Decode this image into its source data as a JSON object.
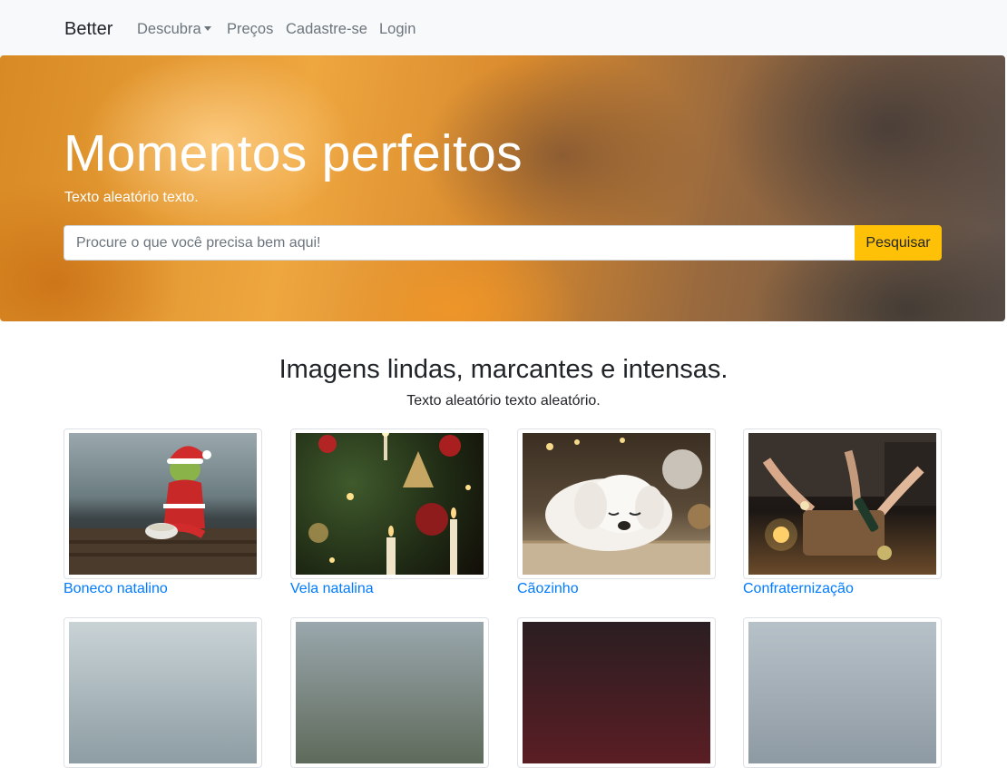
{
  "navbar": {
    "brand": "Better",
    "items": [
      {
        "label": "Descubra",
        "dropdown": true
      },
      {
        "label": "Preços"
      },
      {
        "label": "Cadastre-se"
      },
      {
        "label": "Login"
      }
    ]
  },
  "hero": {
    "title": "Momentos perfeitos",
    "subtitle": "Texto aleatório texto.",
    "search": {
      "placeholder": "Procure o que você precisa bem aqui!",
      "value": "",
      "button_label": "Pesquisar"
    }
  },
  "section": {
    "title": "Imagens lindas, marcantes e intensas.",
    "subtitle": "Texto aleatório texto aleatório."
  },
  "gallery": [
    {
      "caption": "Boneco natalino"
    },
    {
      "caption": "Vela natalina"
    },
    {
      "caption": "Cãozinho"
    },
    {
      "caption": "Confraternização"
    },
    {
      "caption": ""
    },
    {
      "caption": ""
    },
    {
      "caption": ""
    },
    {
      "caption": ""
    }
  ],
  "colors": {
    "accent": "#ffc107",
    "link": "#007bff",
    "navbar_bg": "#f8f9fa",
    "nav_link": "#6c757d"
  }
}
